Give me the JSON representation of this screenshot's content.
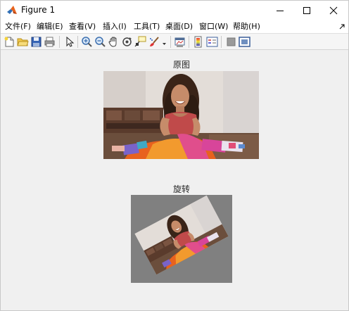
{
  "window": {
    "title": "Figure 1"
  },
  "menu": {
    "items": [
      {
        "label": "文件(F)"
      },
      {
        "label": "编辑(E)"
      },
      {
        "label": "查看(V)"
      },
      {
        "label": "插入(I)"
      },
      {
        "label": "工具(T)"
      },
      {
        "label": "桌面(D)"
      },
      {
        "label": "窗口(W)"
      },
      {
        "label": "帮助(H)"
      }
    ]
  },
  "toolbar": {
    "icons": [
      "new-figure-icon",
      "open-file-icon",
      "save-icon",
      "print-icon",
      "pointer-icon",
      "zoom-in-icon",
      "zoom-out-icon",
      "pan-icon",
      "rotate-3d-icon",
      "data-cursor-icon",
      "brush-icon",
      "brush-dropdown-icon",
      "link-plot-icon",
      "colorbar-icon",
      "legend-icon",
      "hide-plot-tools-icon",
      "show-plot-tools-icon"
    ]
  },
  "axes": [
    {
      "title": "原图"
    },
    {
      "title": "旋转",
      "rotated_background": "#808080"
    }
  ]
}
